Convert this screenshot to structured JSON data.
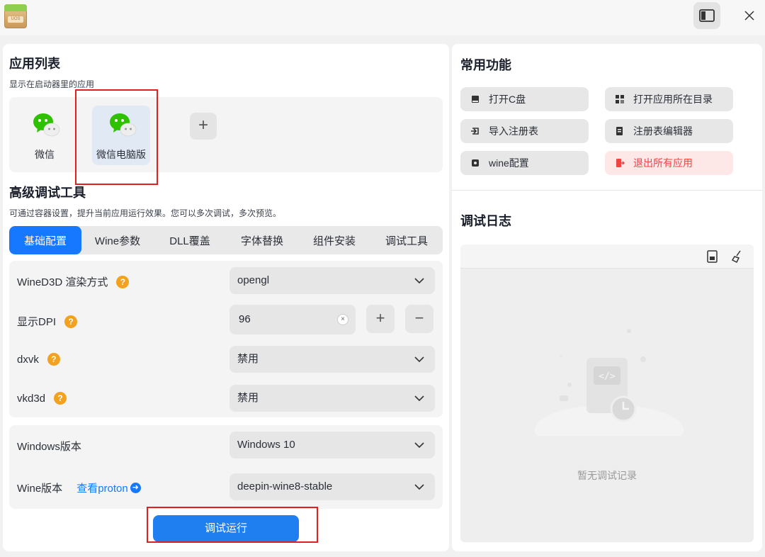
{
  "titlebar": {
    "app_icon_label": "UOS",
    "toggle_icon": "sidebar-toggle-icon",
    "close_icon": "close-icon"
  },
  "app_list": {
    "title": "应用列表",
    "subtitle": "显示在启动器里的应用",
    "apps": [
      {
        "name": "微信",
        "icon": "wechat-icon",
        "selected": false
      },
      {
        "name": "微信电脑版",
        "icon": "wechat-icon",
        "selected": true
      }
    ],
    "add_icon": "plus-icon",
    "add_label": "+"
  },
  "advanced": {
    "title": "高级调试工具",
    "subtitle": "可通过容器设置，提升当前应用运行效果。您可以多次调试，多次预览。",
    "tabs": [
      "基础配置",
      "Wine参数",
      "DLL覆盖",
      "字体替换",
      "组件安装",
      "调试工具"
    ],
    "active_tab": 0
  },
  "settings": {
    "wined3d": {
      "label": "WineD3D 渲染方式",
      "value": "opengl"
    },
    "dpi": {
      "label": "显示DPI",
      "value": "96",
      "inc": "+",
      "dec": "−",
      "clear": "×"
    },
    "dxvk": {
      "label": "dxvk",
      "value": "禁用"
    },
    "vkd3d": {
      "label": "vkd3d",
      "value": "禁用"
    },
    "help_glyph": "?"
  },
  "versions": {
    "windows": {
      "label": "Windows版本",
      "value": "Windows 10"
    },
    "wine": {
      "label": "Wine版本",
      "link": "查看proton",
      "link_arrow": "➜",
      "value": "deepin-wine8-stable"
    }
  },
  "run_button": "调试运行",
  "common": {
    "title": "常用功能",
    "buttons": [
      {
        "label": "打开C盘",
        "icon": "disk-icon"
      },
      {
        "label": "打开应用所在目录",
        "icon": "folder-icon"
      },
      {
        "label": "导入注册表",
        "icon": "import-icon"
      },
      {
        "label": "注册表编辑器",
        "icon": "registry-editor-icon"
      },
      {
        "label": "wine配置",
        "icon": "wine-config-icon"
      },
      {
        "label": "退出所有应用",
        "icon": "exit-apps-icon"
      }
    ]
  },
  "debug_log": {
    "title": "调试日志",
    "tools": [
      "export-log-icon",
      "clear-log-icon"
    ],
    "empty_text": "暂无调试记录"
  },
  "colors": {
    "accent": "#1677ff",
    "danger": "#ee4444",
    "help": "#f3a21f",
    "wechat": "#2dc100",
    "annotation": "#e21f1f"
  }
}
